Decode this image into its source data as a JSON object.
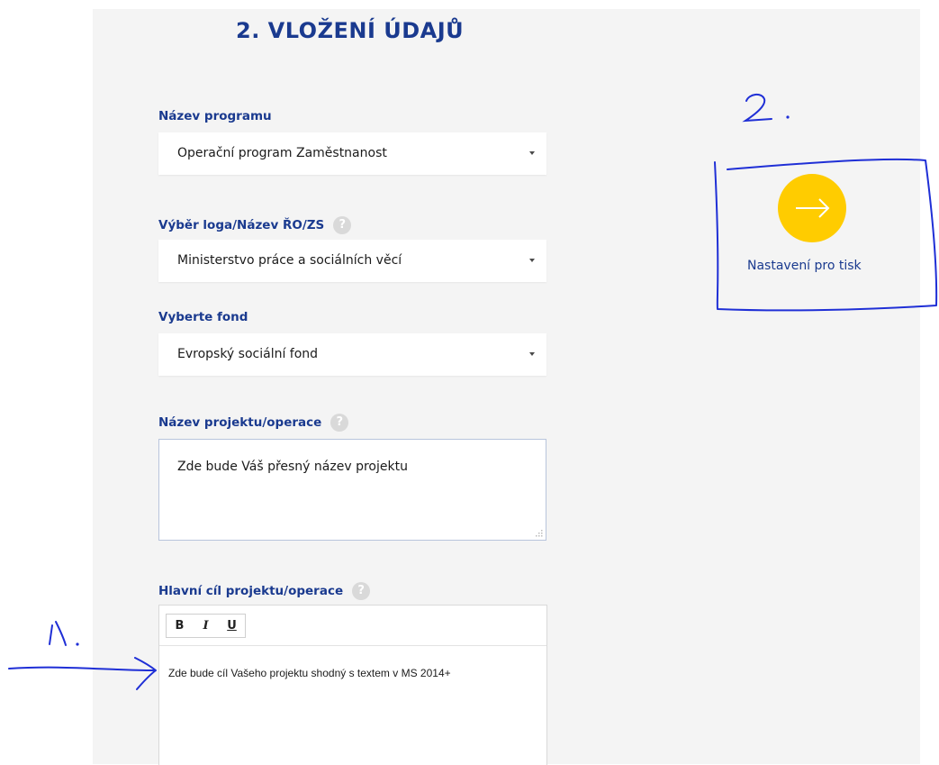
{
  "page": {
    "title": "2. VLOŽENÍ ÚDAJŮ"
  },
  "form": {
    "program": {
      "label": "Název programu",
      "value": "Operační program Zaměstnanost"
    },
    "logo": {
      "label": "Výběr loga/Název ŘO/ZS",
      "value": "Ministerstvo práce a sociálních věcí",
      "help": "?"
    },
    "fund": {
      "label": "Vyberte fond",
      "value": "Evropský sociální fond"
    },
    "project_name": {
      "label": "Název projektu/operace",
      "value": "Zde bude Váš přesný název projektu",
      "help": "?"
    },
    "main_goal": {
      "label": "Hlavní cíl projektu/operace",
      "value": "Zde bude cíl Vašeho projektu shodný s textem v MS 2014+",
      "help": "?",
      "toolbar": {
        "bold": "B",
        "italic": "I",
        "underline": "U"
      }
    }
  },
  "next_step": {
    "label": "Nastavení pro tisk",
    "icon": "arrow-right-icon",
    "color": "#ffcc00"
  },
  "annotations": {
    "mark_1": "1.",
    "mark_2": "2."
  },
  "colors": {
    "accent": "#1a3a8f",
    "panel_bg": "#f4f4f4",
    "annotation": "#1f2fd6"
  }
}
